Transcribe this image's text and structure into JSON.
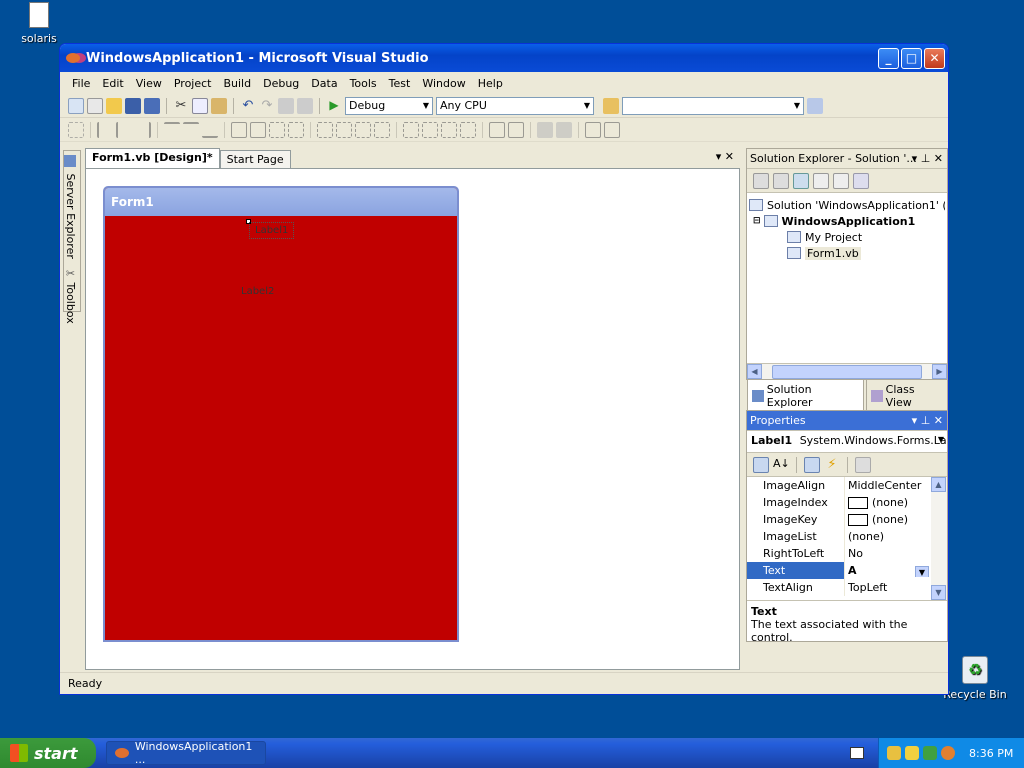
{
  "desktop": {
    "icons": [
      {
        "label": "solaris"
      },
      {
        "label": "Recycle Bin"
      }
    ]
  },
  "window": {
    "title": "WindowsApplication1 - Microsoft Visual Studio",
    "buttons": {
      "minimize": "_",
      "maximize": "□",
      "close": "✕"
    }
  },
  "menu": [
    "File",
    "Edit",
    "View",
    "Project",
    "Build",
    "Debug",
    "Data",
    "Tools",
    "Test",
    "Window",
    "Help"
  ],
  "toolbar": {
    "config": "Debug",
    "platform": "Any CPU",
    "find": ""
  },
  "sidestrip": {
    "server_explorer": "Server Explorer",
    "toolbox": "Toolbox"
  },
  "document": {
    "tabs": [
      "Form1.vb [Design]*",
      "Start Page"
    ],
    "controls": "▾  ✕",
    "form": {
      "title": "Form1",
      "label1": "Label1",
      "label2": "Label2",
      "backcolor": "#c00000"
    }
  },
  "status": "Ready",
  "solution_explorer": {
    "title": "Solution Explorer - Solution '...",
    "controls": "▾ ⊥ ✕",
    "tree": [
      "Solution 'WindowsApplication1' (1 pr",
      "WindowsApplication1",
      "My Project",
      "Form1.vb"
    ],
    "tabs": [
      "Solution Explorer",
      "Class View"
    ]
  },
  "properties": {
    "title": "Properties",
    "controls": "▾ ⊥ ✕",
    "object": "Label1",
    "object_type": "System.Windows.Forms.Labe",
    "rows": [
      {
        "name": "ImageAlign",
        "value": "MiddleCenter"
      },
      {
        "name": "ImageIndex",
        "value": "(none)"
      },
      {
        "name": "ImageKey",
        "value": "(none)"
      },
      {
        "name": "ImageList",
        "value": "(none)"
      },
      {
        "name": "RightToLeft",
        "value": "No"
      },
      {
        "name": "Text",
        "value": "A"
      },
      {
        "name": "TextAlign",
        "value": "TopLeft"
      }
    ],
    "desc_title": "Text",
    "desc_text": "The text associated with the control."
  },
  "taskbar": {
    "start": "start",
    "item": "WindowsApplication1 ...",
    "time": "8:36 PM"
  }
}
